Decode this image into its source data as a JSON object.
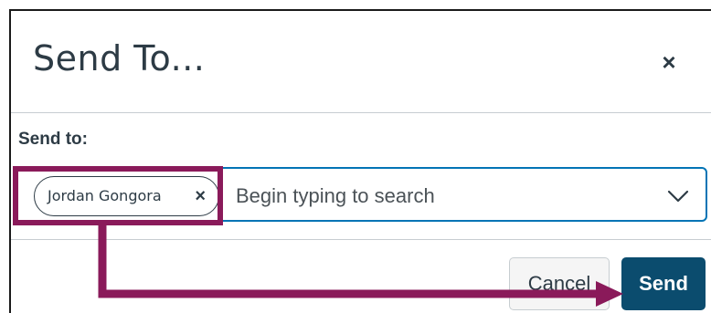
{
  "dialog": {
    "title": "Send To...",
    "close_glyph": "×"
  },
  "recipient": {
    "label": "Send to:",
    "chips": [
      {
        "name": "Jordan Gongora",
        "remove_glyph": "×"
      }
    ],
    "search_placeholder": "Begin typing to search"
  },
  "footer": {
    "cancel_label": "Cancel",
    "send_label": "Send"
  },
  "annotation": {
    "color": "#8a1a5a"
  },
  "colors": {
    "focus_border": "#0374b5",
    "send_button": "#0b4c6e",
    "text": "#2d3b45"
  }
}
